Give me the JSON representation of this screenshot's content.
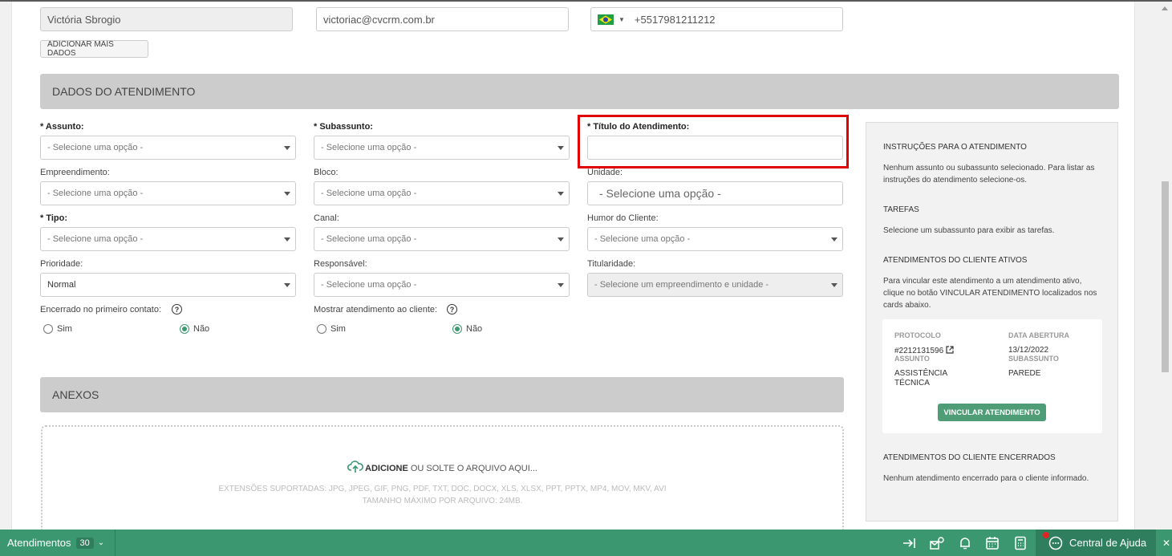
{
  "contact": {
    "name": "Victória Sbrogio",
    "email": "victoriac@cvcrm.com.br",
    "phone": "+5517981211212",
    "add_more_label": "ADICIONAR MAIS DADOS"
  },
  "section_dados": "DADOS DO ATENDIMENTO",
  "form": {
    "assunto_label": "* Assunto:",
    "subassunto_label": "* Subassunto:",
    "titulo_label": "* Título do Atendimento:",
    "titulo_value": "",
    "empreendimento_label": "Empreendimento:",
    "bloco_label": "Bloco:",
    "unidade_label": "Unidade:",
    "tipo_label": "* Tipo:",
    "canal_label": "Canal:",
    "humor_label": "Humor do Cliente:",
    "prioridade_label": "Prioridade:",
    "responsavel_label": "Responsável:",
    "titularidade_label": "Titularidade:",
    "placeholder": "- Selecione uma opção -",
    "prioridade_value": "Normal",
    "titularidade_placeholder": "- Selecione um empreendimento e unidade -",
    "encerrado_label": "Encerrado no primeiro contato:",
    "mostrar_label": "Mostrar atendimento ao cliente:",
    "sim": "Sim",
    "nao": "Não",
    "help": "?"
  },
  "section_anexos": "ANEXOS",
  "upload": {
    "action": "ADICIONE",
    "rest": " OU SOLTE O ARQUIVO AQUI...",
    "extensions": "EXTENSÕES SUPORTADAS: JPG, JPEG, GIF, PNG, PDF, TXT, DOC, DOCX, XLS, XLSX, PPT, PPTX, MP4, MOV, MKV, AVI",
    "max_size": "TAMANHO MÁXIMO POR ARQUIVO: 24MB."
  },
  "side": {
    "instr_title": "INSTRUÇÕES PARA O ATENDIMENTO",
    "instr_text": "Nenhum assunto ou subassunto selecionado. Para listar as instruções do atendimento selecione-os.",
    "tarefas_title": "TAREFAS",
    "tarefas_text": "Selecione um subassunto para exibir as tarefas.",
    "ativos_title": "ATENDIMENTOS DO CLIENTE ATIVOS",
    "ativos_text": "Para vincular este atendimento a um atendimento ativo, clique no botão VINCULAR ATENDIMENTO localizados nos cards abaixo.",
    "card": {
      "protocolo_h": "PROTOCOLO",
      "protocolo_v": "#2212131596",
      "data_h": "DATA ABERTURA",
      "data_v": "13/12/2022",
      "assunto_h": "ASSUNTO",
      "assunto_v": "ASSISTÊNCIA TÉCNICA",
      "subassunto_h": "SUBASSUNTO",
      "subassunto_v": "PAREDE",
      "button": "VINCULAR ATENDIMENTO"
    },
    "encerrados_title": "ATENDIMENTOS DO CLIENTE ENCERRADOS",
    "encerrados_text": "Nenhum atendimento encerrado para o cliente informado."
  },
  "bottom": {
    "atendimentos": "Atendimentos",
    "count": "30",
    "help": "Central de Ajuda"
  },
  "colors": {
    "accent": "#3a9770",
    "highlight": "#e00000"
  }
}
